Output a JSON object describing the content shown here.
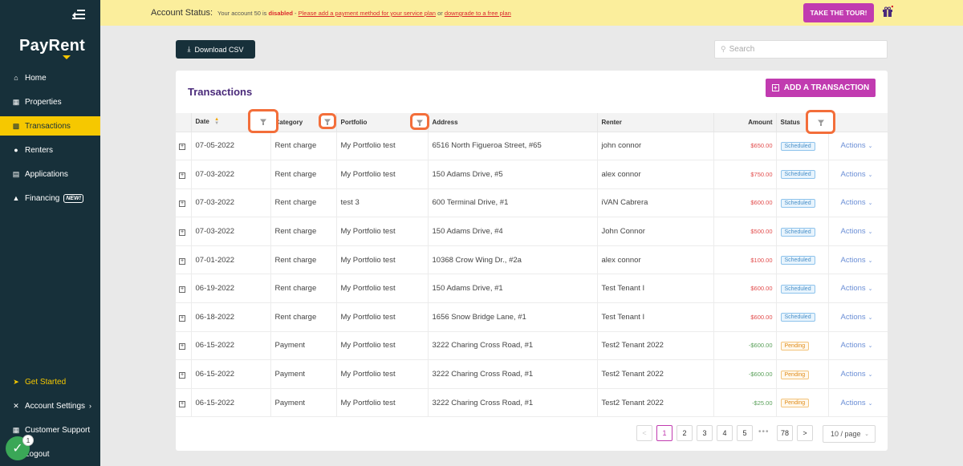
{
  "app": {
    "logo_text": "PayRent"
  },
  "sidebar": {
    "items": [
      {
        "label": "Home",
        "icon": "home-icon"
      },
      {
        "label": "Properties",
        "icon": "properties-icon"
      },
      {
        "label": "Transactions",
        "icon": "transactions-icon",
        "active": true
      },
      {
        "label": "Renters",
        "icon": "renters-icon"
      },
      {
        "label": "Applications",
        "icon": "applications-icon"
      },
      {
        "label": "Financing",
        "icon": "financing-icon",
        "badge": "NEW!"
      }
    ],
    "bottom_items": [
      {
        "label": "Get Started",
        "icon": "rocket-icon"
      },
      {
        "label": "Account Settings",
        "icon": "settings-icon"
      },
      {
        "label": "Customer Support",
        "icon": "support-icon"
      },
      {
        "label": "Logout",
        "icon": "logout-icon"
      }
    ],
    "chat_count": "1"
  },
  "banner": {
    "title": "Account Status:",
    "msg_prefix": "Your account 50 is ",
    "msg_disabled": "disabled",
    "msg_dash": " - ",
    "link_payment": "Please add a payment method for your service plan",
    "msg_or": " or ",
    "link_downgrade": "downgrade to a free plan",
    "tour_label": "TAKE THE TOUR!"
  },
  "toolbar": {
    "download_label": "Download CSV",
    "search_placeholder": "Search"
  },
  "card": {
    "title": "Transactions",
    "add_label": "ADD A TRANSACTION"
  },
  "table": {
    "headers": {
      "date": "Date",
      "category": "Category",
      "portfolio": "Portfolio",
      "address": "Address",
      "renter": "Renter",
      "amount": "Amount",
      "status": "Status"
    },
    "rows": [
      {
        "date": "07-05-2022",
        "category": "Rent charge",
        "portfolio": "My Portfolio test",
        "address": "6516 North Figueroa Street, #65",
        "renter": "john connor",
        "amount": "$650.00",
        "amount_type": "red",
        "status": "Scheduled",
        "actions": "Actions"
      },
      {
        "date": "07-03-2022",
        "category": "Rent charge",
        "portfolio": "My Portfolio test",
        "address": "150 Adams Drive, #5",
        "renter": "alex connor",
        "amount": "$750.00",
        "amount_type": "red",
        "status": "Scheduled",
        "actions": "Actions"
      },
      {
        "date": "07-03-2022",
        "category": "Rent charge",
        "portfolio": "test 3",
        "address": "600 Terminal Drive, #1",
        "renter": "iVAN Cabrera",
        "amount": "$600.00",
        "amount_type": "red",
        "status": "Scheduled",
        "actions": "Actions"
      },
      {
        "date": "07-03-2022",
        "category": "Rent charge",
        "portfolio": "My Portfolio test",
        "address": "150 Adams Drive, #4",
        "renter": "John Connor",
        "amount": "$500.00",
        "amount_type": "red",
        "status": "Scheduled",
        "actions": "Actions"
      },
      {
        "date": "07-01-2022",
        "category": "Rent charge",
        "portfolio": "My Portfolio test",
        "address": "10368 Crow Wing Dr., #2a",
        "renter": "alex connor",
        "amount": "$100.00",
        "amount_type": "red",
        "status": "Scheduled",
        "actions": "Actions"
      },
      {
        "date": "06-19-2022",
        "category": "Rent charge",
        "portfolio": "My Portfolio test",
        "address": "150 Adams Drive, #1",
        "renter": "Test Tenant I",
        "amount": "$600.00",
        "amount_type": "red",
        "status": "Scheduled",
        "actions": "Actions"
      },
      {
        "date": "06-18-2022",
        "category": "Rent charge",
        "portfolio": "My Portfolio test",
        "address": "1656 Snow Bridge Lane, #1",
        "renter": "Test Tenant I",
        "amount": "$600.00",
        "amount_type": "red",
        "status": "Scheduled",
        "actions": "Actions"
      },
      {
        "date": "06-15-2022",
        "category": "Payment",
        "portfolio": "My Portfolio test",
        "address": "3222 Charing Cross Road, #1",
        "renter": "Test2 Tenant 2022",
        "amount": "-$600.00",
        "amount_type": "green",
        "status": "Pending",
        "actions": "Actions"
      },
      {
        "date": "06-15-2022",
        "category": "Payment",
        "portfolio": "My Portfolio test",
        "address": "3222 Charing Cross Road, #1",
        "renter": "Test2 Tenant 2022",
        "amount": "-$600.00",
        "amount_type": "green",
        "status": "Pending",
        "actions": "Actions"
      },
      {
        "date": "06-15-2022",
        "category": "Payment",
        "portfolio": "My Portfolio test",
        "address": "3222 Charing Cross Road, #1",
        "renter": "Test2 Tenant 2022",
        "amount": "-$25.00",
        "amount_type": "green",
        "status": "Pending",
        "actions": "Actions"
      }
    ]
  },
  "pagination": {
    "prev": "<",
    "pages": [
      "1",
      "2",
      "3",
      "4",
      "5"
    ],
    "current": "1",
    "ellipsis": "•••",
    "last": "78",
    "next": ">",
    "page_size": "10 / page"
  },
  "colors": {
    "sidebar_bg": "#17303a",
    "accent_yellow": "#f6c800",
    "brand_purple": "#c13bb0",
    "banner_bg": "#fbee9c",
    "highlight_orange": "#f36e3a"
  }
}
